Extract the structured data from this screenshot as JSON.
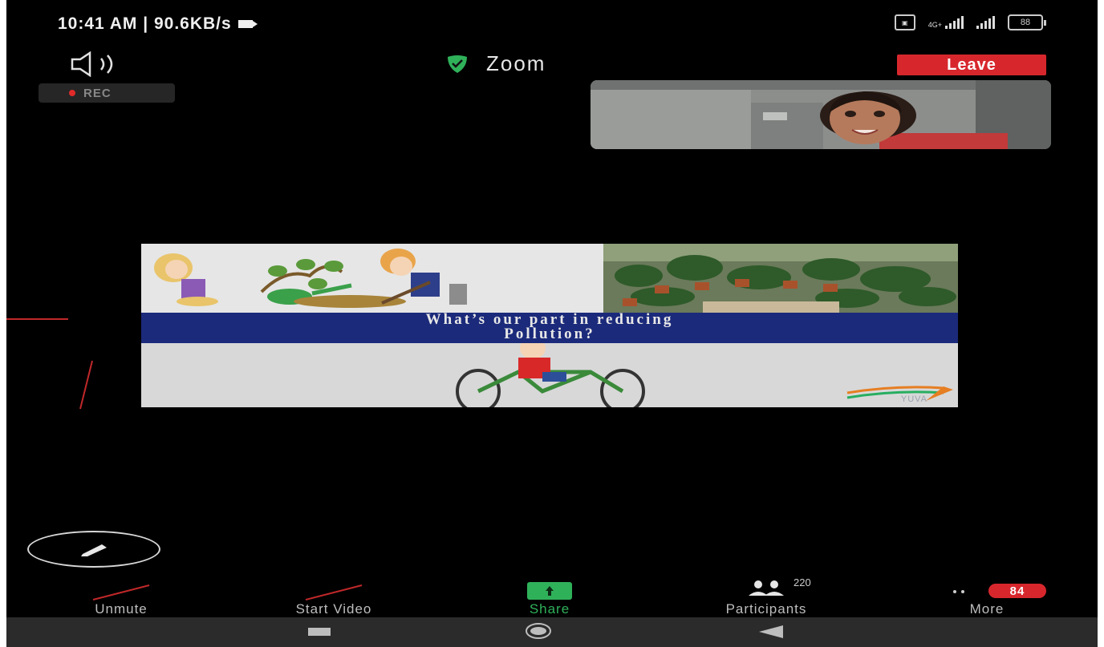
{
  "status_bar": {
    "time_speed": "10:41 AM | 90.6KB/s",
    "network_label": "4G+",
    "battery_level": "88",
    "icons": [
      "camera-icon",
      "volte-icon",
      "signal-icon",
      "battery-icon"
    ]
  },
  "meeting": {
    "title": "Zoom",
    "leave_label": "Leave",
    "rec_label": "REC",
    "icons": [
      "speaker-icon",
      "shield-check-icon",
      "pencil-icon"
    ]
  },
  "shared_screen": {
    "title": "What’s our part in reducing\nPollution?",
    "logo_text": "YUVA"
  },
  "toolbar": {
    "unmute_label": "Unmute",
    "start_video_label": "Start Video",
    "share_label": "Share",
    "participants_label": "Participants",
    "participants_count": "220",
    "more_label": "More",
    "more_badge": "84"
  },
  "colors": {
    "leave_red": "#d7272d",
    "share_green": "#2fb15a",
    "slide_banner": "#1b2a7a"
  }
}
